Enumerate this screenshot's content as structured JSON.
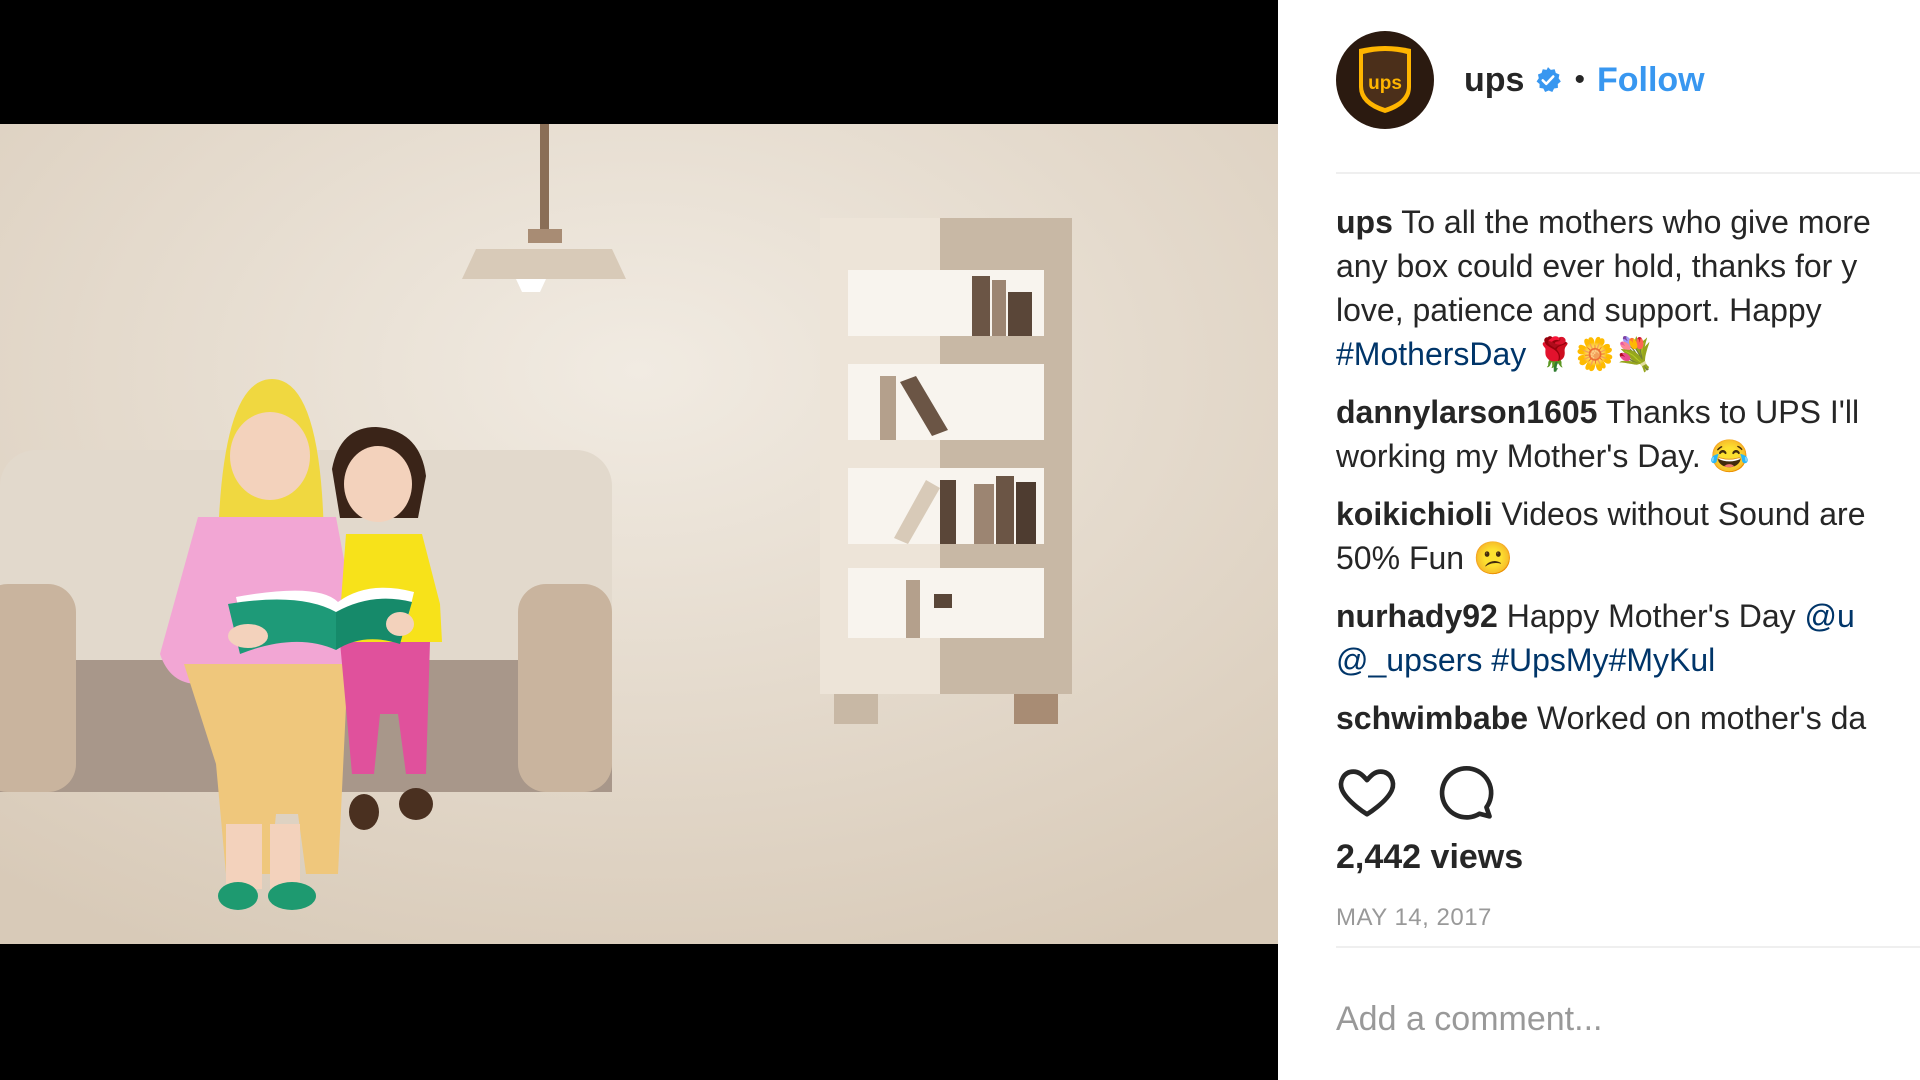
{
  "post": {
    "username": "ups",
    "follow_label": "Follow",
    "separator": "•",
    "views": "2,442 views",
    "date": "MAY 14, 2017",
    "add_comment_placeholder": "Add a comment..."
  },
  "avatar": {
    "logo_text": "ups"
  },
  "caption": {
    "author": "ups",
    "line1": "To all the mothers who give more",
    "line2": "any box could ever hold, thanks for y",
    "line3": "love, patience and support. Happy",
    "hashtag": "#MothersDay",
    "emoji": "🌹🌼💐"
  },
  "comments": [
    {
      "author": "dannylarson1605",
      "text1": "Thanks to UPS I'll",
      "text2": "working my Mother's Day. 😂"
    },
    {
      "author": "koikichioli",
      "text1": "Videos without Sound are",
      "text2": "50% Fun 😕"
    },
    {
      "author": "nurhady92",
      "text1": "Happy Mother's Day",
      "mention1": "@u",
      "mention2": "@_upsers",
      "tag1": "#UpsMy",
      "tag2": "#MyKul"
    },
    {
      "author": "schwimbabe",
      "text1": "Worked on mother's da"
    }
  ],
  "colors": {
    "follow": "#3897f0",
    "hashtag": "#003569",
    "wall": "#e6dccf",
    "letterbox": "#000000"
  }
}
